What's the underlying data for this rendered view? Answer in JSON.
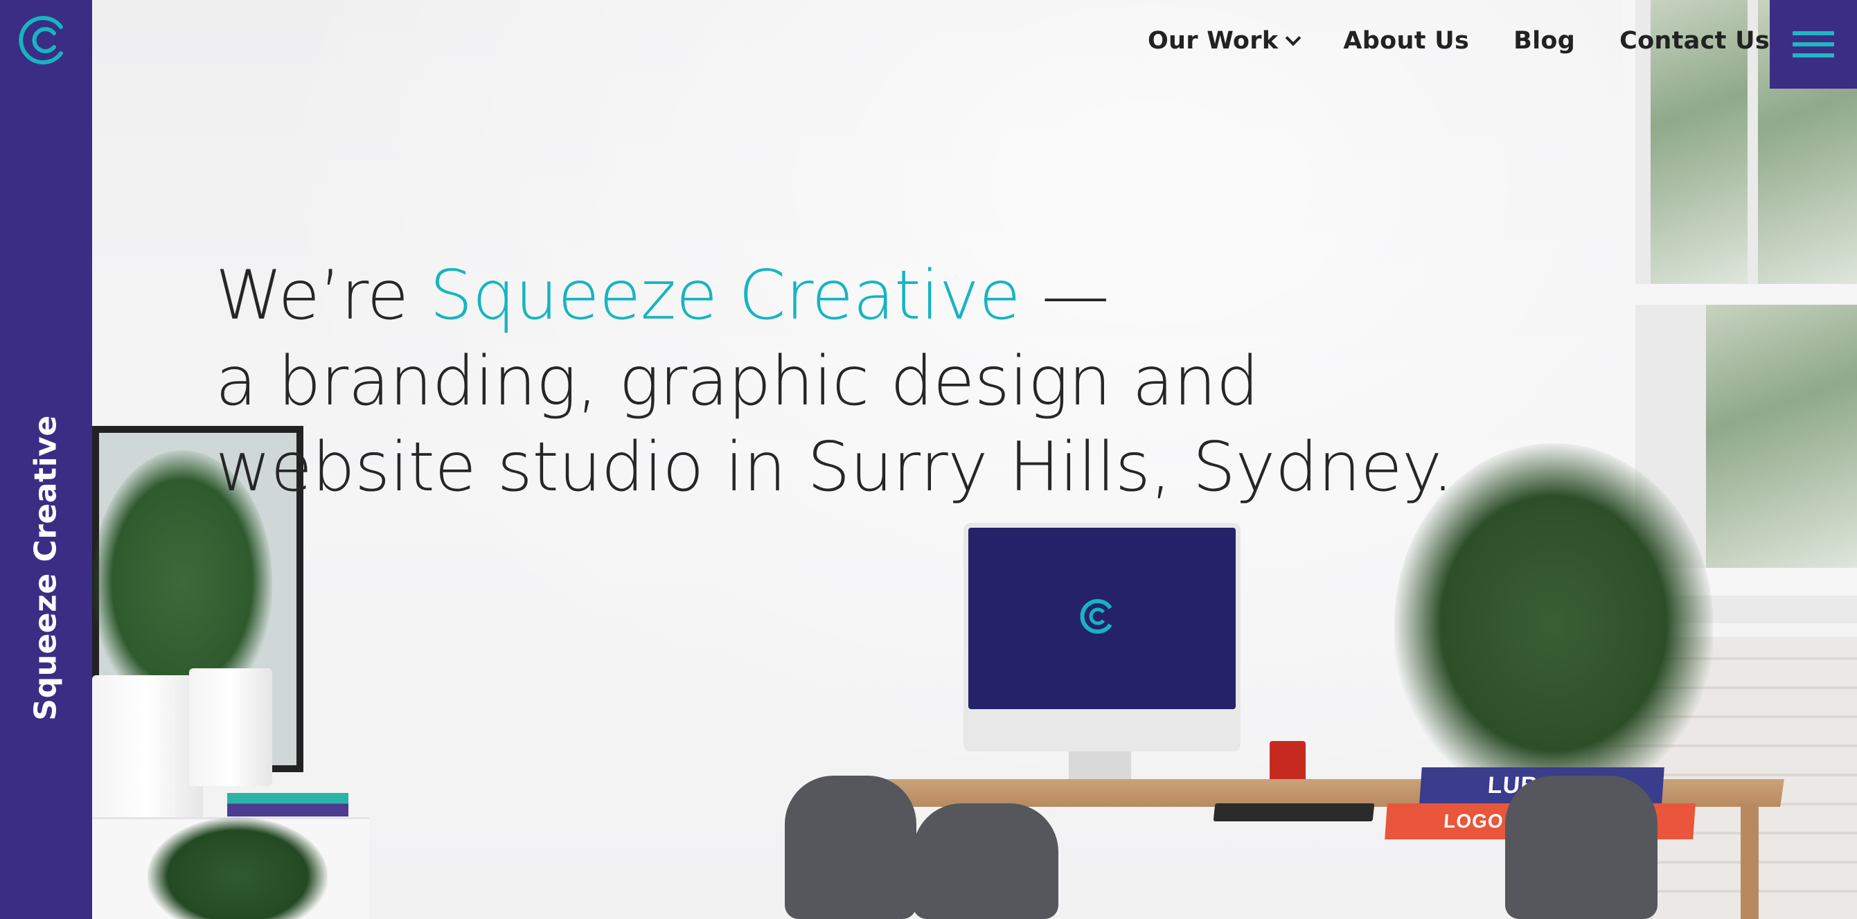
{
  "brand": {
    "name": "Squeeze Creative",
    "logo_icon": "squeeze-c-logo-icon",
    "sidebar_color": "#3b2d84",
    "accent_color": "#17b4c1"
  },
  "nav": {
    "items": [
      {
        "label": "Our Work",
        "has_dropdown": true
      },
      {
        "label": "About Us",
        "has_dropdown": false
      },
      {
        "label": "Blog",
        "has_dropdown": false
      },
      {
        "label": "Contact Us",
        "has_dropdown": false
      }
    ],
    "menu_icon": "hamburger-menu-icon"
  },
  "hero": {
    "headline_prefix": "We’re ",
    "headline_accent": "Squeeze Creative",
    "headline_suffix": " —",
    "headline_line2": "a branding, graphic design and",
    "headline_line3": "website studio in Surry Hills, Sydney."
  },
  "scene": {
    "book_1": "LUBALIN",
    "book_2": "LOGO MODERNISM"
  }
}
